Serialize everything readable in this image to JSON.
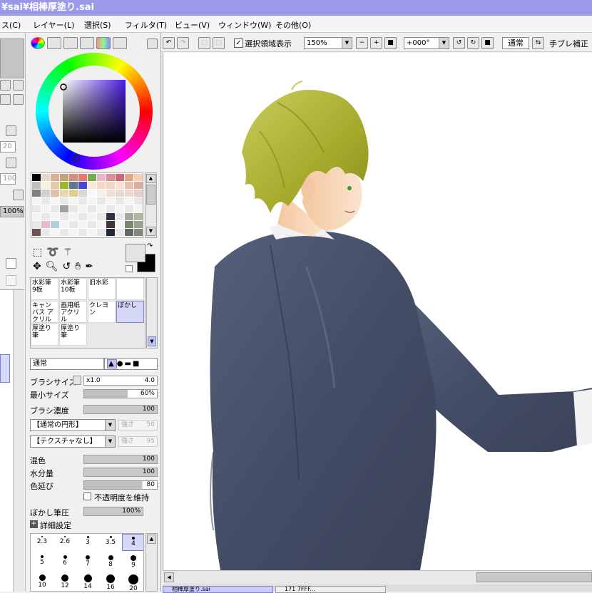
{
  "window": {
    "title": "¥sai¥相棒厚塗り.sai"
  },
  "menu": [
    "ス(C)",
    "レイヤー(L)",
    "選択(S)",
    "フィルタ(T)",
    "ビュー(V)",
    "ウィンドウ(W)",
    "その他(O)"
  ],
  "left_strip": {
    "values": [
      "20",
      "100",
      "100%"
    ]
  },
  "toolbar": {
    "selection_label": "選択領域表示",
    "zoom": "150%",
    "angle": "+000°",
    "mode": "通常",
    "stabilizer_label": "手ブレ補正"
  },
  "brush_tools": [
    {
      "label": "水彩筆 9板"
    },
    {
      "label": "水彩筆 10板"
    },
    {
      "label": "旧水彩"
    },
    {
      "label": ""
    },
    {
      "label": "キャンバス アクリル"
    },
    {
      "label": "画用紙 アクリル"
    },
    {
      "label": "クレヨン"
    },
    {
      "label": "ぼかし"
    },
    {
      "label": "厚塗り筆"
    },
    {
      "label": "厚塗り筆"
    }
  ],
  "brush_settings": {
    "blend_mode": "通常",
    "size_label": "ブラシサイズ",
    "size_multiplier": "x1.0",
    "size_value": "4.0",
    "min_size_label": "最小サイズ",
    "min_size_value": "60%",
    "density_label": "ブラシ濃度",
    "density_value": "100",
    "shape": "【通常の円形】",
    "shape_strength_label": "強さ",
    "shape_strength": "50",
    "texture": "【テクスチャなし】",
    "texture_strength_label": "強さ",
    "texture_strength": "95",
    "blend_label": "混色",
    "blend_value": "100",
    "water_label": "水分量",
    "water_value": "100",
    "stretch_label": "色延び",
    "stretch_value": "80",
    "keep_opacity_label": "不透明度を維持",
    "blur_pressure_label": "ぼかし筆圧",
    "blur_pressure_value": "100%",
    "advanced_label": "詳細設定"
  },
  "brush_size_presets": [
    {
      "label": "2.3",
      "dot": 2
    },
    {
      "label": "2.6",
      "dot": 2
    },
    {
      "label": "3",
      "dot": 3
    },
    {
      "label": "3.5",
      "dot": 3
    },
    {
      "label": "4",
      "dot": 4
    },
    {
      "label": "5",
      "dot": 4
    },
    {
      "label": "6",
      "dot": 5
    },
    {
      "label": "7",
      "dot": 6
    },
    {
      "label": "8",
      "dot": 7
    },
    {
      "label": "9",
      "dot": 8
    },
    {
      "label": "10",
      "dot": 9
    },
    {
      "label": "12",
      "dot": 10
    },
    {
      "label": "14",
      "dot": 11
    },
    {
      "label": "16",
      "dot": 12
    },
    {
      "label": "20",
      "dot": 14
    }
  ],
  "palette": {
    "swatches": [
      "#000000",
      "#e8d8c8",
      "#d8b098",
      "#c8a080",
      "#d09080",
      "#e87878",
      "#78a850",
      "#e8b8c8",
      "#d89098",
      "#c86878",
      "#e0a888",
      "#f0d0b8",
      "#c0c0c0",
      "#f8f0e0",
      "#e8c8a8",
      "#98b828",
      "#607898",
      "#4848d8",
      "#f8e8d8",
      "#f8d8c0",
      "#f0d8c8",
      "#f8e0d0",
      "#e8c0b0",
      "#d8b0a0",
      "#808080",
      "#d0d0d0",
      "#e0c0a8",
      "#e8d8b0",
      "#e0d090",
      "#d8d8d8",
      "#f8f8f8",
      "#f8f0e8",
      "#f0e0d8",
      "#e8d8d0",
      "#f0d8d0",
      "#e8d0c8",
      "#ffffff",
      "#ffffff",
      "#ffffff",
      "#ffffff",
      "#ffffff",
      "#ffffff",
      "#ffffff",
      "#ffffff",
      "#ffffff",
      "#ffffff",
      "#ffffff",
      "#ffffff",
      "#ffffff",
      "#ffffff",
      "#ffffff",
      "#a0a0a0",
      "#ffffff",
      "#ffffff",
      "#ffffff",
      "#ffffff",
      "#ffffff",
      "#ffffff",
      "#ffffff",
      "#ffffff",
      "#ffffff",
      "#ffffff",
      "#ffffff",
      "#ffffff",
      "#ffffff",
      "#ffffff",
      "#ffffff",
      "#ffffff",
      "#303048",
      "#ffffff",
      "#a0a8a0",
      "#b0b8a0",
      "#ffffff",
      "#e8b8d0",
      "#b0d0e0",
      "#ffffff",
      "#ffffff",
      "#ffffff",
      "#ffffff",
      "#ffffff",
      "#403838",
      "#ffffff",
      "#788868",
      "#98a090",
      "#705050",
      "#ffffff",
      "#ffffff",
      "#ffffff",
      "#ffffff",
      "#ffffff",
      "#ffffff",
      "#ffffff",
      "#202838",
      "#ffffff",
      "#606860",
      "#808878"
    ],
    "fg_color": "#e4e4e4",
    "bg_color": "#000000"
  },
  "tabs": [
    "相棒厚塗り.sai",
    "171 7FFF..."
  ]
}
